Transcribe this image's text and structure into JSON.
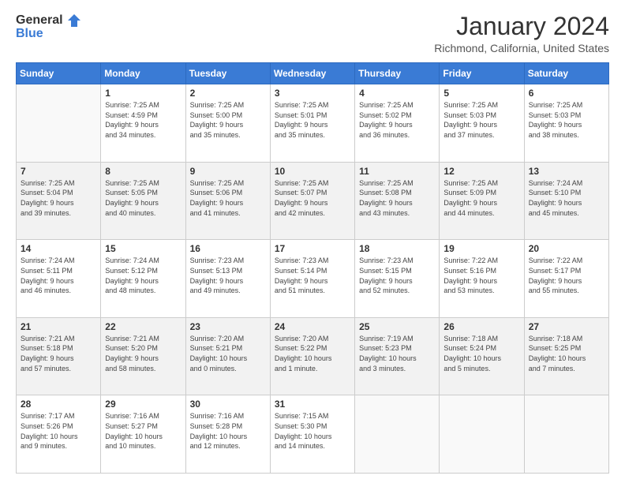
{
  "header": {
    "logo_line1": "General",
    "logo_line2": "Blue",
    "month_year": "January 2024",
    "location": "Richmond, California, United States"
  },
  "weekdays": [
    "Sunday",
    "Monday",
    "Tuesday",
    "Wednesday",
    "Thursday",
    "Friday",
    "Saturday"
  ],
  "weeks": [
    [
      {
        "day": "",
        "info": ""
      },
      {
        "day": "1",
        "info": "Sunrise: 7:25 AM\nSunset: 4:59 PM\nDaylight: 9 hours\nand 34 minutes."
      },
      {
        "day": "2",
        "info": "Sunrise: 7:25 AM\nSunset: 5:00 PM\nDaylight: 9 hours\nand 35 minutes."
      },
      {
        "day": "3",
        "info": "Sunrise: 7:25 AM\nSunset: 5:01 PM\nDaylight: 9 hours\nand 35 minutes."
      },
      {
        "day": "4",
        "info": "Sunrise: 7:25 AM\nSunset: 5:02 PM\nDaylight: 9 hours\nand 36 minutes."
      },
      {
        "day": "5",
        "info": "Sunrise: 7:25 AM\nSunset: 5:03 PM\nDaylight: 9 hours\nand 37 minutes."
      },
      {
        "day": "6",
        "info": "Sunrise: 7:25 AM\nSunset: 5:03 PM\nDaylight: 9 hours\nand 38 minutes."
      }
    ],
    [
      {
        "day": "7",
        "info": "Sunrise: 7:25 AM\nSunset: 5:04 PM\nDaylight: 9 hours\nand 39 minutes."
      },
      {
        "day": "8",
        "info": "Sunrise: 7:25 AM\nSunset: 5:05 PM\nDaylight: 9 hours\nand 40 minutes."
      },
      {
        "day": "9",
        "info": "Sunrise: 7:25 AM\nSunset: 5:06 PM\nDaylight: 9 hours\nand 41 minutes."
      },
      {
        "day": "10",
        "info": "Sunrise: 7:25 AM\nSunset: 5:07 PM\nDaylight: 9 hours\nand 42 minutes."
      },
      {
        "day": "11",
        "info": "Sunrise: 7:25 AM\nSunset: 5:08 PM\nDaylight: 9 hours\nand 43 minutes."
      },
      {
        "day": "12",
        "info": "Sunrise: 7:25 AM\nSunset: 5:09 PM\nDaylight: 9 hours\nand 44 minutes."
      },
      {
        "day": "13",
        "info": "Sunrise: 7:24 AM\nSunset: 5:10 PM\nDaylight: 9 hours\nand 45 minutes."
      }
    ],
    [
      {
        "day": "14",
        "info": "Sunrise: 7:24 AM\nSunset: 5:11 PM\nDaylight: 9 hours\nand 46 minutes."
      },
      {
        "day": "15",
        "info": "Sunrise: 7:24 AM\nSunset: 5:12 PM\nDaylight: 9 hours\nand 48 minutes."
      },
      {
        "day": "16",
        "info": "Sunrise: 7:23 AM\nSunset: 5:13 PM\nDaylight: 9 hours\nand 49 minutes."
      },
      {
        "day": "17",
        "info": "Sunrise: 7:23 AM\nSunset: 5:14 PM\nDaylight: 9 hours\nand 51 minutes."
      },
      {
        "day": "18",
        "info": "Sunrise: 7:23 AM\nSunset: 5:15 PM\nDaylight: 9 hours\nand 52 minutes."
      },
      {
        "day": "19",
        "info": "Sunrise: 7:22 AM\nSunset: 5:16 PM\nDaylight: 9 hours\nand 53 minutes."
      },
      {
        "day": "20",
        "info": "Sunrise: 7:22 AM\nSunset: 5:17 PM\nDaylight: 9 hours\nand 55 minutes."
      }
    ],
    [
      {
        "day": "21",
        "info": "Sunrise: 7:21 AM\nSunset: 5:18 PM\nDaylight: 9 hours\nand 57 minutes."
      },
      {
        "day": "22",
        "info": "Sunrise: 7:21 AM\nSunset: 5:20 PM\nDaylight: 9 hours\nand 58 minutes."
      },
      {
        "day": "23",
        "info": "Sunrise: 7:20 AM\nSunset: 5:21 PM\nDaylight: 10 hours\nand 0 minutes."
      },
      {
        "day": "24",
        "info": "Sunrise: 7:20 AM\nSunset: 5:22 PM\nDaylight: 10 hours\nand 1 minute."
      },
      {
        "day": "25",
        "info": "Sunrise: 7:19 AM\nSunset: 5:23 PM\nDaylight: 10 hours\nand 3 minutes."
      },
      {
        "day": "26",
        "info": "Sunrise: 7:18 AM\nSunset: 5:24 PM\nDaylight: 10 hours\nand 5 minutes."
      },
      {
        "day": "27",
        "info": "Sunrise: 7:18 AM\nSunset: 5:25 PM\nDaylight: 10 hours\nand 7 minutes."
      }
    ],
    [
      {
        "day": "28",
        "info": "Sunrise: 7:17 AM\nSunset: 5:26 PM\nDaylight: 10 hours\nand 9 minutes."
      },
      {
        "day": "29",
        "info": "Sunrise: 7:16 AM\nSunset: 5:27 PM\nDaylight: 10 hours\nand 10 minutes."
      },
      {
        "day": "30",
        "info": "Sunrise: 7:16 AM\nSunset: 5:28 PM\nDaylight: 10 hours\nand 12 minutes."
      },
      {
        "day": "31",
        "info": "Sunrise: 7:15 AM\nSunset: 5:30 PM\nDaylight: 10 hours\nand 14 minutes."
      },
      {
        "day": "",
        "info": ""
      },
      {
        "day": "",
        "info": ""
      },
      {
        "day": "",
        "info": ""
      }
    ]
  ]
}
